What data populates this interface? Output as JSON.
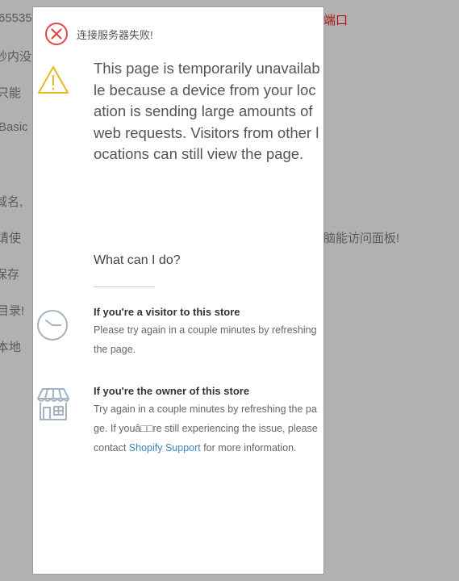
{
  "background": {
    "fragments": [
      {
        "text": "65535",
        "red": false
      },
      {
        "text": "端口",
        "red": true
      },
      {
        "text": "秒内没",
        "red": false
      },
      {
        "text": "只能",
        "red": false
      },
      {
        "text": "Basic",
        "red": false
      },
      {
        "text": "域名,",
        "red": false
      },
      {
        "text": "请使",
        "red": false
      },
      {
        "text": "脑能访问面板!",
        "red": false
      },
      {
        "text": "保存",
        "red": false
      },
      {
        "text": "目录!",
        "red": false
      },
      {
        "text": "本地",
        "red": false
      }
    ]
  },
  "dialog": {
    "title": "连接服务器失败!",
    "error_icon": "error-circle-x-icon",
    "warning_icon": "warning-triangle-icon",
    "message": "This page is temporarily unavailable because a device from your location is sending large amounts of web requests. Visitors from other locations can still view the page.",
    "what_can_i_do": "What can I do?",
    "visitor": {
      "icon": "clock-icon",
      "title": "If you're a visitor to this store",
      "body": "Please try again in a couple minutes by refreshing the page."
    },
    "owner": {
      "icon": "storefront-icon",
      "title": "If you're the owner of this store",
      "body_before": "Try again in a couple minutes by refreshing the page. If youâ□□re still experiencing the issue, please contact ",
      "link_text": "Shopify Support",
      "body_after": " for more information."
    },
    "colors": {
      "backdrop": "#b1b1b1",
      "error_red": "#e04646",
      "warning_yellow": "#e8b923",
      "icon_gray": "#a3b3c2",
      "link": "#3a86b8"
    }
  }
}
